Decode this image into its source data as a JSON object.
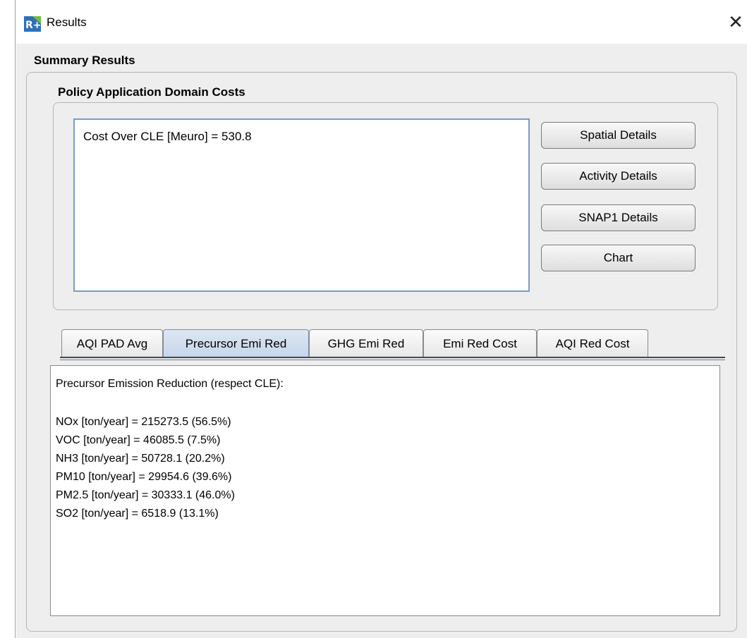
{
  "window": {
    "title": "Results",
    "close_symbol": "✕",
    "icon": "r-plus-app-icon",
    "icon_text": "R+"
  },
  "summary": {
    "title": "Summary Results"
  },
  "pad": {
    "title": "Policy Application Domain Costs",
    "cost_text": "Cost Over CLE [Meuro]  = 530.8"
  },
  "buttons": {
    "spatial": "Spatial Details",
    "activity": "Activity Details",
    "snap1": "SNAP1 Details",
    "chart": "Chart"
  },
  "tabs": [
    {
      "label": "AQI PAD Avg",
      "active": false
    },
    {
      "label": "Precursor Emi Red",
      "active": true
    },
    {
      "label": "GHG Emi Red",
      "active": false
    },
    {
      "label": "Emi Red Cost",
      "active": false
    },
    {
      "label": "AQI Red Cost",
      "active": false
    }
  ],
  "results": {
    "heading": "Precursor Emission Reduction (respect CLE):",
    "lines": [
      "NOx [ton/year] = 215273.5 (56.5%)",
      "VOC [ton/year] = 46085.5 (7.5%)",
      "NH3 [ton/year] = 50728.1 (20.2%)",
      "PM10 [ton/year] = 29954.6 (39.6%)",
      "PM2.5 [ton/year] = 30333.1 (46.0%)",
      "SO2 [ton/year] = 6518.9 (13.1%)"
    ]
  },
  "colors": {
    "active_tab": "#c5d5ea",
    "focus_border": "#7a9cc6",
    "panel_bg": "#eeeeee"
  }
}
